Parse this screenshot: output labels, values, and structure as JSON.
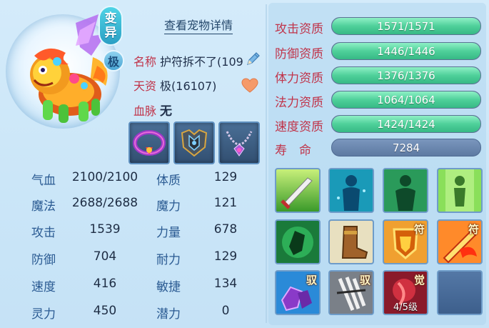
{
  "pet": {
    "mutation_badge": [
      "变",
      "异"
    ],
    "grade_badge": "极",
    "view_detail_label": "查看宠物详情",
    "name_label": "名称",
    "name_value": "护符拆不了(109",
    "talent_label": "天资",
    "talent_value": "极(16107)",
    "bloodline_label": "血脉",
    "bloodline_value": "无"
  },
  "icons": {
    "edit": "pencil-icon",
    "favorite": "heart-icon",
    "equipment": [
      "collar-equipment-icon",
      "armor-equipment-icon",
      "necklace-equipment-icon"
    ]
  },
  "stats_left": [
    {
      "label": "气血",
      "value": "2100/2100"
    },
    {
      "label": "魔法",
      "value": "2688/2688"
    },
    {
      "label": "攻击",
      "value": "1539"
    },
    {
      "label": "防御",
      "value": "704"
    },
    {
      "label": "速度",
      "value": "416"
    },
    {
      "label": "灵力",
      "value": "450"
    }
  ],
  "stats_right": [
    {
      "label": "体质",
      "value": "129"
    },
    {
      "label": "魔力",
      "value": "121"
    },
    {
      "label": "力量",
      "value": "678"
    },
    {
      "label": "耐力",
      "value": "129"
    },
    {
      "label": "敏捷",
      "value": "134"
    },
    {
      "label": "潜力",
      "value": "0"
    }
  ],
  "aptitudes": [
    {
      "label": "攻击资质",
      "value": "1571/1571",
      "fill": 1.0
    },
    {
      "label": "防御资质",
      "value": "1446/1446",
      "fill": 1.0
    },
    {
      "label": "体力资质",
      "value": "1376/1376",
      "fill": 1.0
    },
    {
      "label": "法力资质",
      "value": "1064/1064",
      "fill": 1.0
    },
    {
      "label": "速度资质",
      "value": "1424/1424",
      "fill": 1.0
    }
  ],
  "lifespan": {
    "label": "寿　命",
    "value": "7284"
  },
  "skills": [
    {
      "icon": "sword-slash-skill-icon",
      "tag": ""
    },
    {
      "icon": "blue-silhouette-skill-icon",
      "tag": ""
    },
    {
      "icon": "green-silhouette-skill-icon",
      "tag": ""
    },
    {
      "icon": "green-aura-figure-skill-icon",
      "tag": ""
    },
    {
      "icon": "green-shield-warrior-skill-icon",
      "tag": ""
    },
    {
      "icon": "boot-skill-icon",
      "tag": ""
    },
    {
      "icon": "golden-shield-talisman-skill-icon",
      "tag": "符"
    },
    {
      "icon": "flame-sword-talisman-skill-icon",
      "tag": "符"
    },
    {
      "icon": "purple-rock-skill-icon",
      "tag": "驭"
    },
    {
      "icon": "gray-claw-skill-icon",
      "tag": "驭"
    },
    {
      "icon": "red-awakening-skill-icon",
      "tag": "觉",
      "level": "4/5级"
    },
    {
      "icon": "empty-skill-slot",
      "tag": ""
    }
  ],
  "colors": {
    "label_red": "#c0344a",
    "stat_label_blue": "#2a5a92",
    "bar_green": "#4fd09a",
    "bar_track": "#6f88a8"
  }
}
